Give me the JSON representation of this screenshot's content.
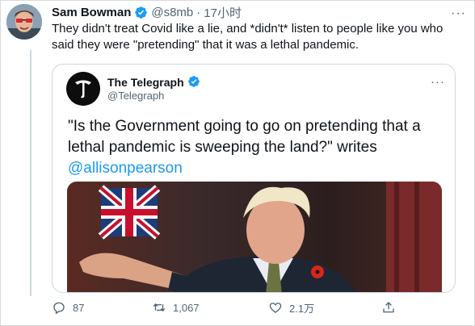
{
  "tweet": {
    "author_name": "Sam Bowman",
    "author_handle": "@s8mb",
    "separator": "·",
    "time": "17小时",
    "more": "···",
    "text": "They didn't treat Covid like a lie, and *didn't* listen to people like you who said they were \"pretending\" that it was a lethal pandemic."
  },
  "quoted": {
    "name": "The Telegraph",
    "handle": "@Telegraph",
    "more": "···",
    "text": "\"Is the Government going to go on pretending that a lethal pandemic is sweeping the land?\" writes",
    "mention": "@allisonpearson"
  },
  "actions": {
    "reply_count": "87",
    "retweet_count": "1,067",
    "like_count": "2.1万",
    "share_label": ""
  },
  "colors": {
    "accent": "#1d9bf0",
    "text": "#0f1419",
    "muted": "#536471",
    "border": "#cfd9de"
  },
  "icons": [
    "verified-badge-icon",
    "reply-icon",
    "retweet-icon",
    "like-icon",
    "share-icon",
    "more-icon"
  ]
}
